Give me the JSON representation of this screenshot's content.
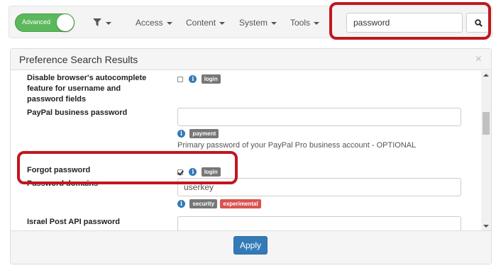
{
  "navbar": {
    "mode_toggle_label": "Advanced",
    "menus": [
      {
        "label": "Access"
      },
      {
        "label": "Content"
      },
      {
        "label": "System"
      },
      {
        "label": "Tools"
      }
    ],
    "search": {
      "value": "password"
    }
  },
  "panel": {
    "title": "Preference Search Results",
    "close": "×",
    "apply_label": "Apply"
  },
  "preferences": [
    {
      "label": "Disable browser's autocomplete feature for username and password fields",
      "checked": false,
      "tags": [
        "login"
      ]
    },
    {
      "label": "PayPal business password",
      "value": "",
      "tags": [
        "payment"
      ],
      "help": "Primary password of your PayPal Pro business account - OPTIONAL"
    },
    {
      "label": "Forgot password",
      "checked": true,
      "tags": [
        "login"
      ]
    },
    {
      "label": "Password domains",
      "value": "userkey",
      "tags": [
        "security",
        "experimental"
      ]
    },
    {
      "label": "Israel Post API password",
      "value": ""
    }
  ],
  "info_glyph": "i",
  "colors": {
    "toggle_green": "#5cb85c",
    "primary_blue": "#337ab7",
    "tag_gray": "#777777",
    "tag_red": "#d9534f",
    "highlight_red": "#c0171f"
  }
}
